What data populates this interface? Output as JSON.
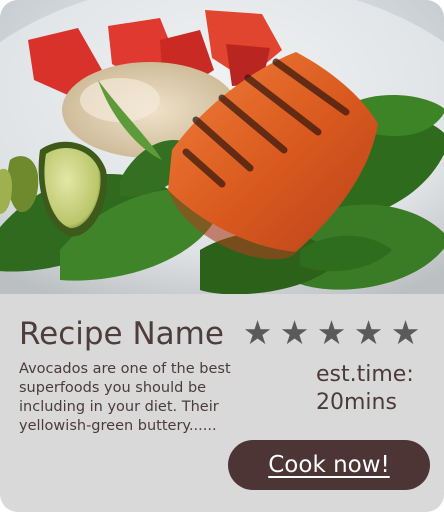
{
  "recipe": {
    "name": "Recipe Name",
    "rating": 5,
    "rating_max": 5,
    "description": "Avocados are one of the best superfoods you should be including in your diet. Their yellowish-green buttery......",
    "est_time_label": "est.time:",
    "est_time_value": "20mins",
    "cta_label": "Cook now!",
    "image_subject": "grilled salmon with spinach, avocado, rice and tomatoes"
  },
  "colors": {
    "card_background": "#d9d9d9",
    "text": "#4d3d3d",
    "button_background": "#4d3535",
    "button_text": "#ffffff",
    "star": "#5a5a5a"
  }
}
